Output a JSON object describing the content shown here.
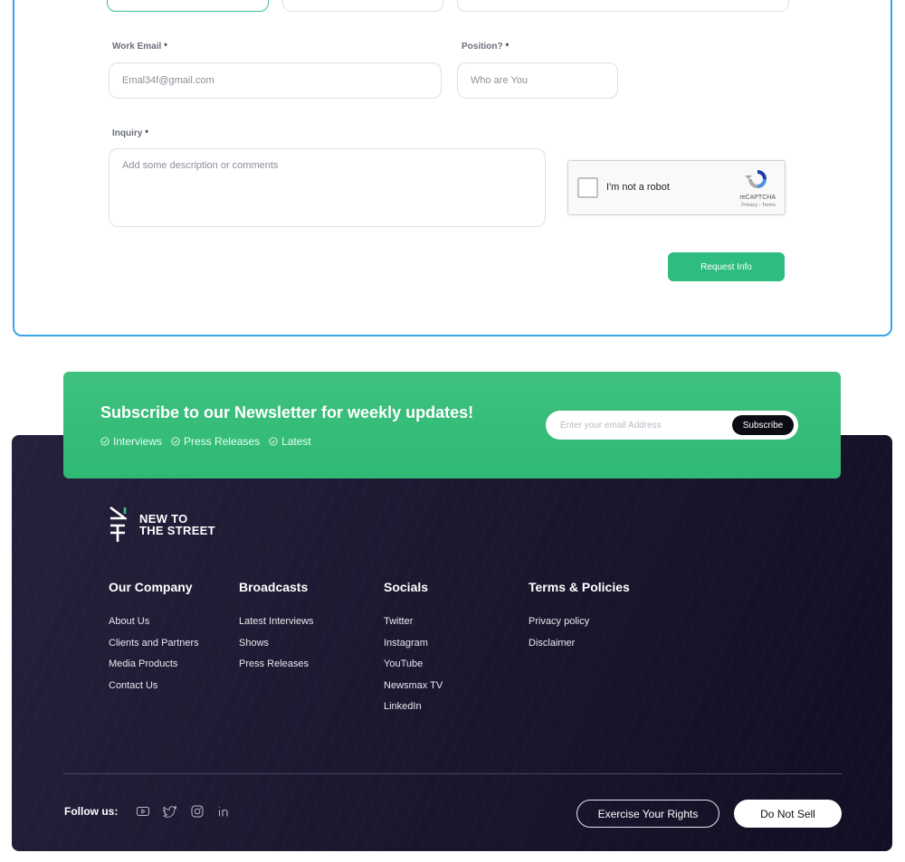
{
  "form": {
    "work_email_label": "Work Email",
    "work_email_placeholder": "Emal34f@gmail.com",
    "position_label": "Position?",
    "position_placeholder": "Who are You",
    "inquiry_label": "Inquiry",
    "inquiry_placeholder": "Add some description or comments",
    "required_mark": "*",
    "captcha_text": "I'm not a robot",
    "captcha_brand": "reCAPTCHA",
    "captcha_links": "Privacy - Terms",
    "submit_label": "Request Info"
  },
  "newsletter": {
    "title": "Subscribe to our Newsletter for weekly updates!",
    "tags": [
      "Interviews",
      "Press Releases",
      "Latest"
    ],
    "email_placeholder": "Enter your email Address",
    "subscribe_label": "Subscribe"
  },
  "footer": {
    "logo_line1": "NEW TO",
    "logo_line2": "THE STREET",
    "columns": [
      {
        "title": "Our Company",
        "links": [
          "About Us",
          "Clients and Partners",
          "Media Products",
          "Contact Us"
        ]
      },
      {
        "title": "Broadcasts",
        "links": [
          "Latest Interviews",
          "Shows",
          "Press Releases"
        ]
      },
      {
        "title": "Socials",
        "links": [
          "Twitter",
          "Instagram",
          "YouTube",
          "Newsmax TV",
          "LinkedIn"
        ]
      },
      {
        "title": "Terms & Policies",
        "links": [
          "Privacy policy",
          "Disclaimer"
        ]
      }
    ],
    "follow_label": "Follow us:",
    "social_icons": [
      "youtube-icon",
      "twitter-icon",
      "instagram-icon",
      "linkedin-icon"
    ],
    "exercise_rights_label": "Exercise Your Rights",
    "do_not_sell_label": "Do Not Sell"
  },
  "colors": {
    "accent_green": "#2fbd7f",
    "card_border": "#3aa3e8",
    "footer_bg": "#1b1830"
  }
}
